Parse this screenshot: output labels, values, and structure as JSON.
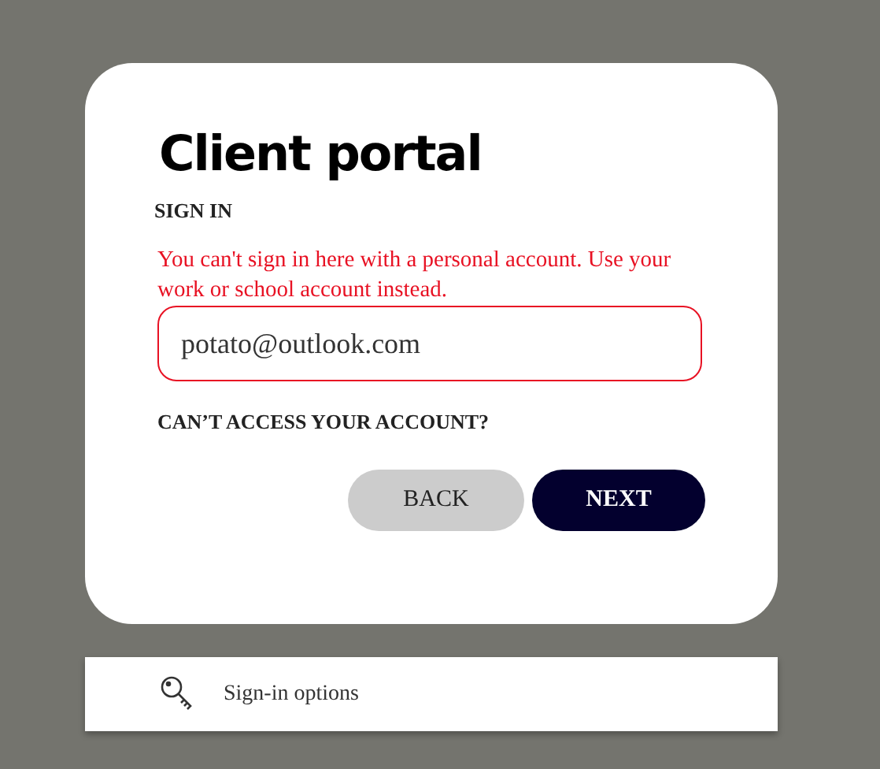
{
  "title": "Client portal",
  "heading": "SIGN IN",
  "error": "You can't sign in here with a personal account. Use your work or school account instead.",
  "field": {
    "value": "potato@outlook.com",
    "invalid": true
  },
  "help_link": "CAN’T ACCESS YOUR ACCOUNT?",
  "buttons": [
    {
      "label": "BACK",
      "kind": "secondary"
    },
    {
      "label": "NEXT",
      "kind": "primary"
    }
  ],
  "options": {
    "label": "Sign-in options"
  }
}
